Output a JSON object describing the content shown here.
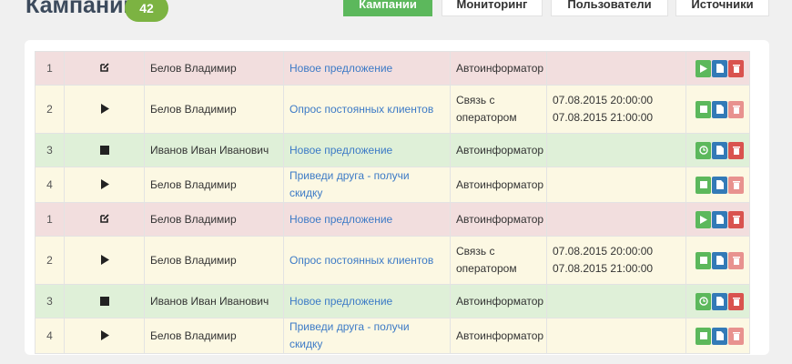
{
  "header": {
    "title": "Кампании",
    "count": "42"
  },
  "nav": [
    "Кампании",
    "Мониторинг",
    "Пользователи",
    "Источники"
  ],
  "rows": [
    {
      "num": "1",
      "status": "edit-icon",
      "owner": "Белов Владимир",
      "name": "Новое предложение",
      "type": "Автоинформатор",
      "time1": "",
      "time2": "",
      "color": "pink",
      "actions": [
        "play-icon",
        "file-icon",
        "trash-icon"
      ]
    },
    {
      "num": "2",
      "status": "play-icon",
      "owner": "Белов Владимир",
      "name": "Опрос постоянных клиентов",
      "type": "Связь с оператором",
      "time1": "07.08.2015 20:00:00",
      "time2": "07.08.2015 21:00:00",
      "color": "yellow",
      "actions": [
        "stop-icon",
        "file-icon",
        "trash-disabled-icon"
      ]
    },
    {
      "num": "3",
      "status": "stop-icon",
      "owner": "Иванов Иван Иванович",
      "name": "Новое предложение",
      "type": "Автоинформатор",
      "time1": "",
      "time2": "",
      "color": "green",
      "actions": [
        "clock-icon",
        "file-icon",
        "trash-icon"
      ]
    },
    {
      "num": "4",
      "status": "play-icon",
      "owner": "Белов Владимир",
      "name": "Приведи друга - получи скидку",
      "type": "Автоинформатор",
      "time1": "",
      "time2": "",
      "color": "yellow",
      "actions": [
        "stop-icon",
        "file-icon",
        "trash-disabled-icon"
      ]
    },
    {
      "num": "1",
      "status": "edit-icon",
      "owner": "Белов Владимир",
      "name": "Новое предложение",
      "type": "Автоинформатор",
      "time1": "",
      "time2": "",
      "color": "pink",
      "actions": [
        "play-icon",
        "file-icon",
        "trash-icon"
      ]
    },
    {
      "num": "2",
      "status": "play-icon",
      "owner": "Белов Владимир",
      "name": "Опрос постоянных клиентов",
      "type": "Связь с оператором",
      "time1": "07.08.2015 20:00:00",
      "time2": "07.08.2015 21:00:00",
      "color": "yellow",
      "actions": [
        "stop-icon",
        "file-icon",
        "trash-disabled-icon"
      ]
    },
    {
      "num": "3",
      "status": "stop-icon",
      "owner": "Иванов Иван Иванович",
      "name": "Новое предложение",
      "type": "Автоинформатор",
      "time1": "",
      "time2": "",
      "color": "green",
      "actions": [
        "clock-icon",
        "file-icon",
        "trash-icon"
      ]
    },
    {
      "num": "4",
      "status": "play-icon",
      "owner": "Белов Владимир",
      "name": "Приведи друга - получи скидку",
      "type": "Автоинформатор",
      "time1": "",
      "time2": "",
      "color": "yellow",
      "actions": [
        "stop-icon",
        "file-icon",
        "trash-disabled-icon"
      ]
    }
  ],
  "colors": {
    "pink": "#f2dede",
    "yellow": "#fcf8e3",
    "green": "#dff0d8",
    "accent": "#5cb85c",
    "badge": "#7cb342"
  }
}
